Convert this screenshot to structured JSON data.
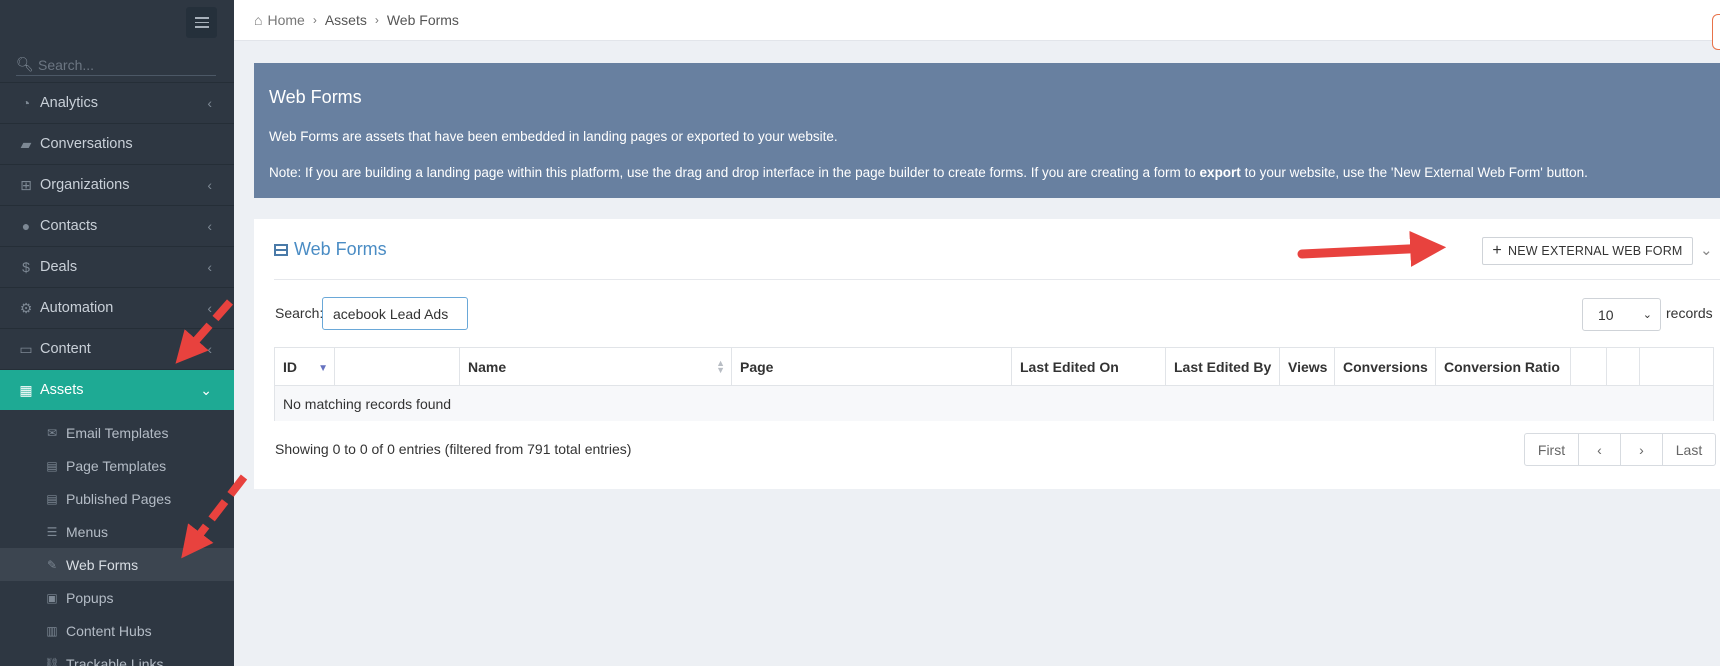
{
  "sidebar": {
    "search_placeholder": "Search...",
    "nav": [
      {
        "label": "Analytics",
        "icon": "gauge-icon",
        "chevron": "‹"
      },
      {
        "label": "Conversations",
        "icon": "comments-icon",
        "chevron": ""
      },
      {
        "label": "Organizations",
        "icon": "sitemap-icon",
        "chevron": "‹"
      },
      {
        "label": "Contacts",
        "icon": "users-icon",
        "chevron": "‹"
      },
      {
        "label": "Deals",
        "icon": "dollar-icon",
        "chevron": "‹"
      },
      {
        "label": "Automation",
        "icon": "cogs-icon",
        "chevron": "‹"
      },
      {
        "label": "Content",
        "icon": "content-icon",
        "chevron": "‹"
      },
      {
        "label": "Assets",
        "icon": "grid-icon",
        "chevron": "⌄"
      }
    ],
    "sub_items": [
      {
        "label": "Email Templates"
      },
      {
        "label": "Page Templates"
      },
      {
        "label": "Published Pages"
      },
      {
        "label": "Menus"
      },
      {
        "label": "Web Forms"
      },
      {
        "label": "Popups"
      },
      {
        "label": "Content Hubs"
      },
      {
        "label": "Trackable Links"
      }
    ]
  },
  "breadcrumb": {
    "home": "Home",
    "assets": "Assets",
    "current": "Web Forms"
  },
  "info": {
    "title": "Web Forms",
    "p1": "Web Forms are assets that have been embedded in landing pages or exported to your website.",
    "p2_a": "Note: If you are building a landing page within this platform, use the drag and drop interface in the page builder to create forms. If you are creating a form to ",
    "p2_bold": "export",
    "p2_b": " to your website, use the 'New External Web Form' button."
  },
  "card": {
    "title": "Web Forms",
    "new_button": "NEW EXTERNAL WEB FORM",
    "search_label": "Search:",
    "search_value": "acebook Lead Ads",
    "page_length": "10",
    "records_label": "records",
    "columns": [
      "ID",
      "",
      "Name",
      "Page",
      "Last Edited On",
      "Last Edited By",
      "Views",
      "Conversions",
      "Conversion Ratio",
      "",
      "",
      ""
    ],
    "empty_message": "No matching records found",
    "info_text": "Showing 0 to 0 of 0 entries (filtered from 791 total entries)",
    "pager": {
      "first": "First",
      "prev": "‹",
      "next": "›",
      "last": "Last"
    }
  },
  "colors": {
    "sidebar_bg": "#2e3742",
    "active_teal": "#1eaa94",
    "info_bg": "#6880a0",
    "title_blue": "#4a8cc4",
    "arrow_red": "#e8423e"
  }
}
